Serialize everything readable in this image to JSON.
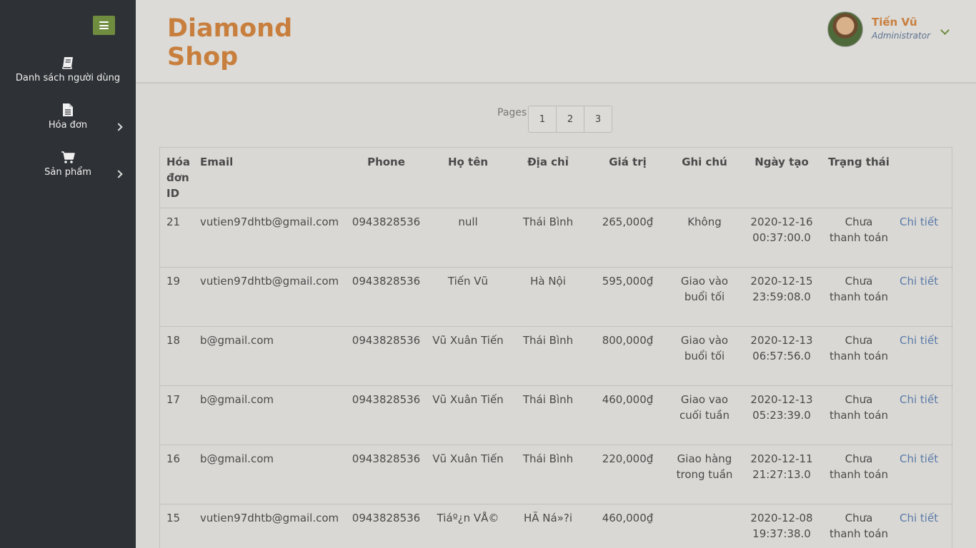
{
  "sidebar": {
    "items": [
      {
        "label": "Danh sách người dùng"
      },
      {
        "label": "Hóa đơn"
      },
      {
        "label": "Sản phẩm"
      }
    ]
  },
  "header": {
    "brand_line1": "Diamond",
    "brand_line2": "Shop",
    "user_name": "Tiến Vũ",
    "user_role": "Administrator"
  },
  "pagination": {
    "label": "Pages",
    "pages": [
      "1",
      "2",
      "3"
    ]
  },
  "table": {
    "headers": {
      "id": "Hóa đơn ID",
      "email": "Email",
      "phone": "Phone",
      "name": "Họ tên",
      "address": "Địa chỉ",
      "value": "Giá trị",
      "note": "Ghi chú",
      "created": "Ngày tạo",
      "status": "Trạng thái"
    },
    "rows": [
      {
        "id": "21",
        "email": "vutien97dhtb@gmail.com",
        "phone": "0943828536",
        "name": "null",
        "address": "Thái Bình",
        "value": "265,000₫",
        "note": "Không",
        "created": "2020-12-16 00:37:00.0",
        "status": "Chưa thanh toán",
        "action": "Chi tiết"
      },
      {
        "id": "19",
        "email": "vutien97dhtb@gmail.com",
        "phone": "0943828536",
        "name": "Tiến Vũ",
        "address": "Hà Nội",
        "value": "595,000₫",
        "note": "Giao vào buổi tối",
        "created": "2020-12-15 23:59:08.0",
        "status": "Chưa thanh toán",
        "action": "Chi tiết"
      },
      {
        "id": "18",
        "email": "b@gmail.com",
        "phone": "0943828536",
        "name": "Vũ Xuân Tiến",
        "address": "Thái Bình",
        "value": "800,000₫",
        "note": "Giao vào buổi tối",
        "created": "2020-12-13 06:57:56.0",
        "status": "Chưa thanh toán",
        "action": "Chi tiết"
      },
      {
        "id": "17",
        "email": "b@gmail.com",
        "phone": "0943828536",
        "name": "Vũ Xuân Tiến",
        "address": "Thái Bình",
        "value": "460,000₫",
        "note": "Giao vao cuối tuần",
        "created": "2020-12-13 05:23:39.0",
        "status": "Chưa thanh toán",
        "action": "Chi tiết"
      },
      {
        "id": "16",
        "email": "b@gmail.com",
        "phone": "0943828536",
        "name": "Vũ Xuân Tiến",
        "address": "Thái Bình",
        "value": "220,000₫",
        "note": "Giao hàng trong tuần",
        "created": "2020-12-11 21:27:13.0",
        "status": "Chưa thanh toán",
        "action": "Chi tiết"
      },
      {
        "id": "15",
        "email": "vutien97dhtb@gmail.com",
        "phone": "0943828536",
        "name": "Tiáº¿n VÅ©",
        "address": "HÃ  Ná»?i",
        "value": "460,000₫",
        "note": "",
        "created": "2020-12-08 19:37:38.0",
        "status": "Chưa thanh toán",
        "action": "Chi tiết"
      }
    ]
  }
}
